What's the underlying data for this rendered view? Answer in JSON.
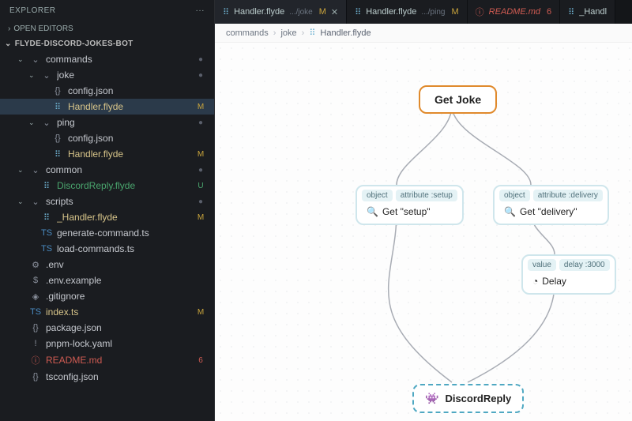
{
  "sidebar": {
    "title": "EXPLORER",
    "openEditors": "OPEN EDITORS",
    "project": "FLYDE-DISCORD-JOKES-BOT",
    "tree": [
      {
        "label": "commands",
        "kind": "folder",
        "indent": 1,
        "open": true,
        "dot": true
      },
      {
        "label": "joke",
        "kind": "folder",
        "indent": 2,
        "open": true,
        "dot": true
      },
      {
        "label": "config.json",
        "kind": "json",
        "indent": 3
      },
      {
        "label": "Handler.flyde",
        "kind": "flyde",
        "indent": 3,
        "status": "M",
        "selected": true
      },
      {
        "label": "ping",
        "kind": "folder",
        "indent": 2,
        "open": true,
        "dot": true
      },
      {
        "label": "config.json",
        "kind": "json",
        "indent": 3
      },
      {
        "label": "Handler.flyde",
        "kind": "flyde",
        "indent": 3,
        "status": "M"
      },
      {
        "label": "common",
        "kind": "folder",
        "indent": 1,
        "open": true,
        "dot": true
      },
      {
        "label": "DiscordReply.flyde",
        "kind": "flyde",
        "indent": 2,
        "status": "U"
      },
      {
        "label": "scripts",
        "kind": "folder",
        "indent": 1,
        "open": true,
        "dot": true
      },
      {
        "label": "_Handler.flyde",
        "kind": "flyde",
        "indent": 2,
        "status": "M"
      },
      {
        "label": "generate-command.ts",
        "kind": "ts",
        "indent": 2
      },
      {
        "label": "load-commands.ts",
        "kind": "ts",
        "indent": 2
      },
      {
        "label": ".env",
        "kind": "env",
        "indent": 1
      },
      {
        "label": ".env.example",
        "kind": "shell",
        "indent": 1
      },
      {
        "label": ".gitignore",
        "kind": "git",
        "indent": 1
      },
      {
        "label": "index.ts",
        "kind": "ts",
        "indent": 1,
        "status": "M"
      },
      {
        "label": "package.json",
        "kind": "json",
        "indent": 1
      },
      {
        "label": "pnpm-lock.yaml",
        "kind": "yaml",
        "indent": 1
      },
      {
        "label": "README.md",
        "kind": "info",
        "indent": 1,
        "status": "6",
        "deleted": true
      },
      {
        "label": "tsconfig.json",
        "kind": "json",
        "indent": 1
      }
    ]
  },
  "tabs": [
    {
      "icon": "flyde",
      "name": "Handler.flyde",
      "path": ".../joke",
      "status": "M",
      "active": true,
      "close": true
    },
    {
      "icon": "flyde",
      "name": "Handler.flyde",
      "path": ".../ping",
      "status": "M"
    },
    {
      "icon": "info",
      "name": "README.md",
      "status": "6",
      "deleted": true
    },
    {
      "icon": "flyde",
      "name": "_Handl"
    }
  ],
  "breadcrumb": [
    "commands",
    "joke",
    "Handler.flyde"
  ],
  "canvas": {
    "getJoke": "Get Joke",
    "getSetup": {
      "pins": [
        "object",
        "attribute :setup"
      ],
      "body": "Get \"setup\""
    },
    "getDelivery": {
      "pins": [
        "object",
        "attribute :delivery"
      ],
      "body": "Get \"delivery\""
    },
    "delay": {
      "pins": [
        "value",
        "delay :3000"
      ],
      "body": "Delay"
    },
    "discordReply": "DiscordReply"
  },
  "icons": {
    "folder_open": "⌄",
    "folder_closed": "›",
    "json": "{}",
    "flyde": "⠿",
    "ts": "TS",
    "env": "⚙",
    "shell": "$",
    "git": "◈",
    "yaml": "!",
    "info": "ⓘ",
    "search": "🔍",
    "clock": "◔",
    "discord": "👾",
    "more": "···",
    "chev": "›"
  }
}
